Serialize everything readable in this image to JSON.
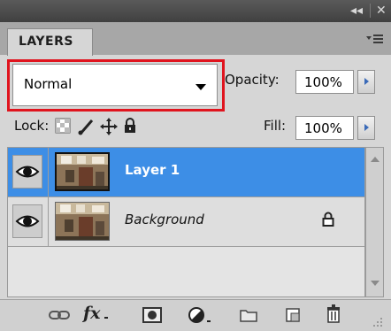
{
  "header": {
    "collapse_icon": "double-chevron-left-icon",
    "collapse_label": "◂◂",
    "close_icon": "close-icon",
    "close_label": "✕"
  },
  "tab": {
    "label": "LAYERS"
  },
  "panel_menu_icon": "panel-menu-icon",
  "blend_mode": {
    "value": "Normal"
  },
  "opacity": {
    "label": "Opacity:",
    "value": "100%"
  },
  "lock": {
    "label": "Lock:",
    "icons": [
      "lock-transparent-pixels-icon",
      "lock-image-pixels-icon",
      "lock-position-icon",
      "lock-all-icon"
    ]
  },
  "fill": {
    "label": "Fill:",
    "value": "100%"
  },
  "layers": [
    {
      "name": "Layer 1",
      "visible": true,
      "selected": true,
      "locked": false
    },
    {
      "name": "Background",
      "visible": true,
      "selected": false,
      "locked": true
    }
  ],
  "bottom_toolbar": {
    "fx_label": "fx",
    "icons": [
      "link-layers-icon",
      "layer-style-fx-icon",
      "add-mask-icon",
      "adjustment-layer-icon",
      "new-group-icon",
      "new-layer-icon",
      "delete-icon"
    ]
  },
  "colors": {
    "selection": "#3d8ee6",
    "highlight_box": "#e0141e",
    "panel_bg": "#d6d6d6",
    "title_bar": "#404040"
  }
}
